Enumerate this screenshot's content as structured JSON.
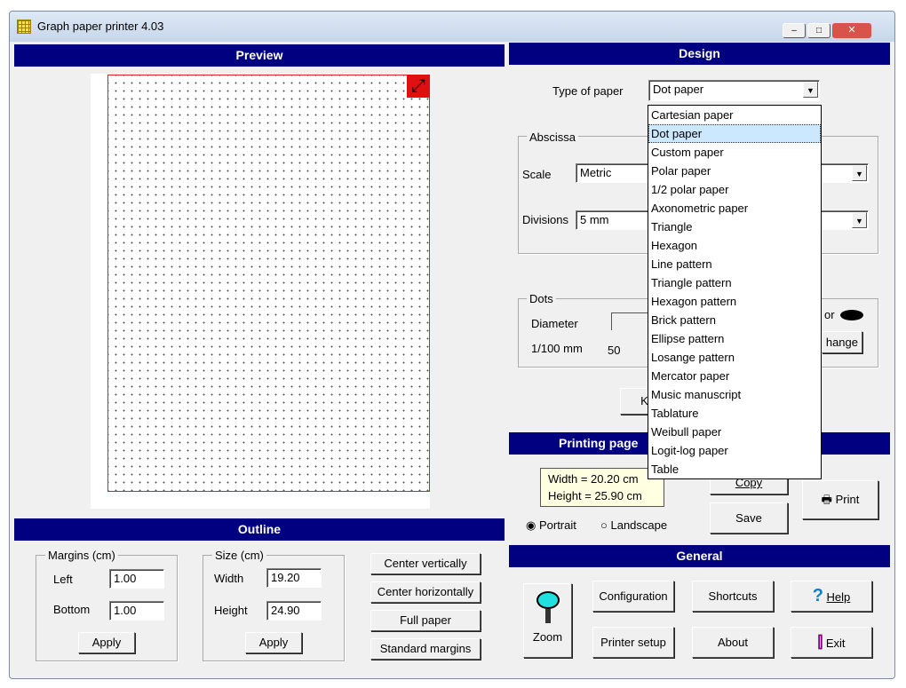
{
  "window": {
    "title": "Graph paper printer 4.03",
    "minimize": "–",
    "maximize": "□",
    "close": "✕"
  },
  "preview": {
    "header": "Preview"
  },
  "design": {
    "header": "Design",
    "type_label": "Type of paper",
    "type_value": "Dot paper",
    "paper_types": [
      "Cartesian paper",
      "Dot paper",
      "Custom paper",
      "Polar paper",
      "1/2 polar paper",
      "Axonometric paper",
      "Triangle",
      "Hexagon",
      "Line pattern",
      "Triangle pattern",
      "Hexagon pattern",
      "Brick pattern",
      "Ellipse pattern",
      "Losange pattern",
      "Mercator paper",
      "Music manuscript",
      "Tablature",
      "Weibull paper",
      "Logit-log paper",
      "Table"
    ],
    "abscissa": {
      "label": "Abscissa",
      "scale_label": "Scale",
      "scale_value": "Metric",
      "divisions_label": "Divisions",
      "divisions_value": "5 mm"
    },
    "dots": {
      "label": "Dots",
      "diameter_label": "Diameter",
      "unit_label": "1/100 mm",
      "slider_min": "50",
      "color_label_partial": "or",
      "change_partial": "hange"
    },
    "keep_partial": "Ke"
  },
  "printing": {
    "header": "Printing page",
    "width": "Width = 20.20 cm",
    "height": "Height = 25.90 cm",
    "portrait": "Portrait",
    "landscape": "Landscape",
    "copy": "Copy",
    "save": "Save",
    "print": "Print"
  },
  "outline": {
    "header": "Outline",
    "margins_label": "Margins (cm)",
    "left_label": "Left",
    "left_value": "1.00",
    "bottom_label": "Bottom",
    "bottom_value": "1.00",
    "apply1": "Apply",
    "size_label": "Size (cm)",
    "width_label": "Width",
    "width_value": "19.20",
    "height_label": "Height",
    "height_value": "24.90",
    "apply2": "Apply",
    "center_v": "Center vertically",
    "center_h": "Center horizontally",
    "full": "Full paper",
    "standard": "Standard margins"
  },
  "general": {
    "header": "General",
    "zoom": "Zoom",
    "configuration": "Configuration",
    "shortcuts": "Shortcuts",
    "help": "Help",
    "printer_setup": "Printer setup",
    "about": "About",
    "exit": "Exit"
  }
}
